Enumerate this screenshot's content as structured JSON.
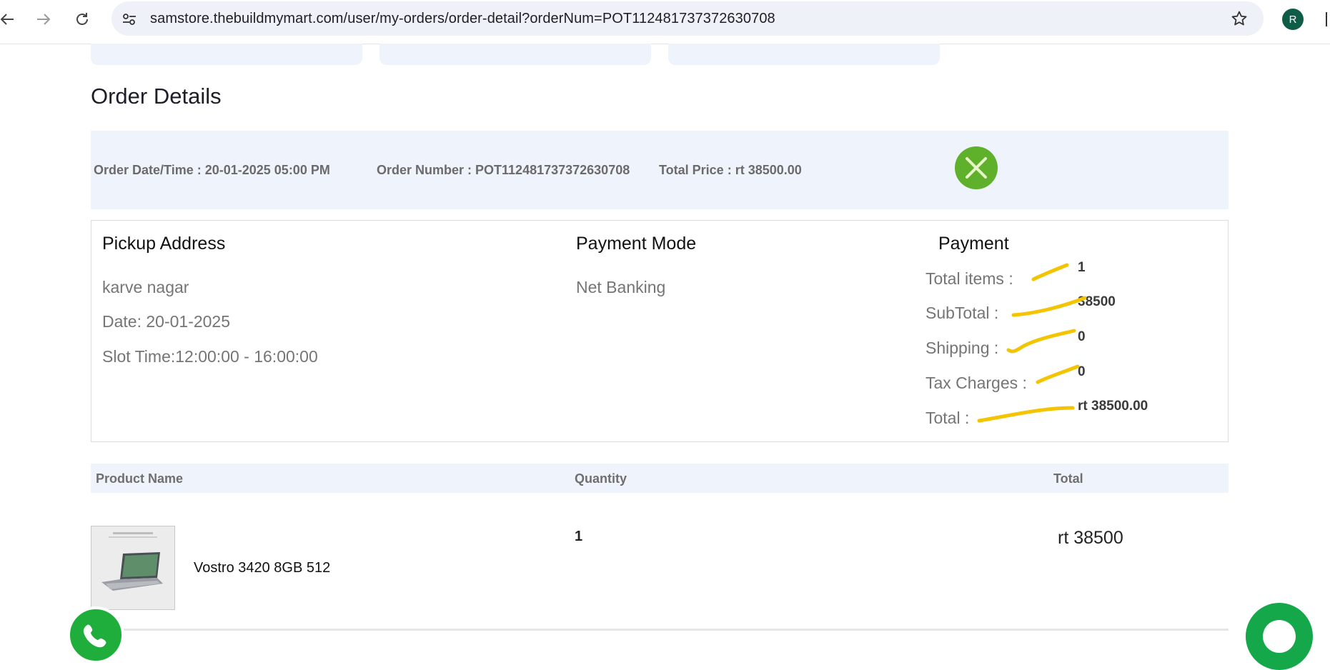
{
  "browser": {
    "url": "samstore.thebuildmymart.com/user/my-orders/order-detail?orderNum=POT112481737372630708",
    "profile_initial": "R"
  },
  "page": {
    "title": "Order Details"
  },
  "summary": {
    "order_date": "Order Date/Time : 20-01-2025 05:00 PM",
    "order_number": "Order Number : POT112481737372630708",
    "total_price": "Total Price : rt 38500.00",
    "status_icon": "cancel-x-icon"
  },
  "pickup": {
    "heading": "Pickup Address",
    "address": "karve nagar",
    "date": "Date: 20-01-2025",
    "slot": "Slot Time:12:00:00 - 16:00:00"
  },
  "payment_mode": {
    "heading": "Payment Mode",
    "value": "Net Banking"
  },
  "payment": {
    "heading": "Payment",
    "rows": [
      {
        "label": "Total items :",
        "value": "1"
      },
      {
        "label": "SubTotal :",
        "value": "38500"
      },
      {
        "label": "Shipping :",
        "value": "0"
      },
      {
        "label": "Tax Charges :",
        "value": "0"
      },
      {
        "label": "Total :",
        "value": "rt 38500.00"
      }
    ]
  },
  "table": {
    "headers": {
      "product": "Product Name",
      "quantity": "Quantity",
      "total": "Total"
    },
    "rows": [
      {
        "name": "Vostro 3420 8GB 512",
        "quantity": "1",
        "total": "rt 38500"
      }
    ]
  },
  "colors": {
    "accent_bg": "#eef3fc",
    "status_green": "#5fb02b",
    "annotation_yellow": "#f5c400",
    "whatsapp_green": "#1fae3b"
  }
}
